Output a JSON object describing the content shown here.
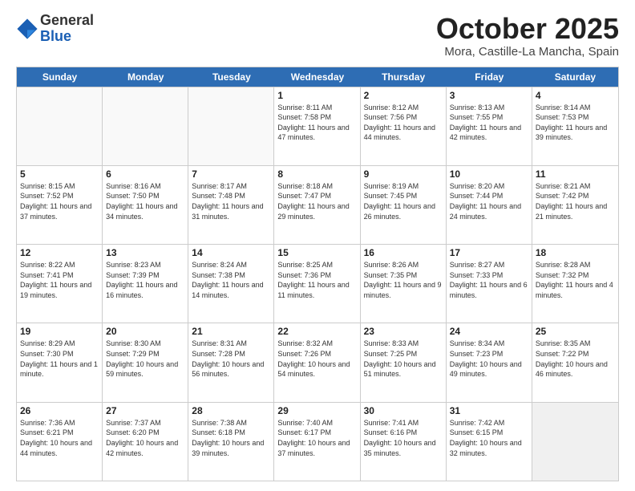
{
  "logo": {
    "general": "General",
    "blue": "Blue"
  },
  "header": {
    "month": "October 2025",
    "location": "Mora, Castille-La Mancha, Spain"
  },
  "weekdays": [
    "Sunday",
    "Monday",
    "Tuesday",
    "Wednesday",
    "Thursday",
    "Friday",
    "Saturday"
  ],
  "weeks": [
    [
      {
        "day": "",
        "info": "",
        "empty": true
      },
      {
        "day": "",
        "info": "",
        "empty": true
      },
      {
        "day": "",
        "info": "",
        "empty": true
      },
      {
        "day": "1",
        "info": "Sunrise: 8:11 AM\nSunset: 7:58 PM\nDaylight: 11 hours and 47 minutes."
      },
      {
        "day": "2",
        "info": "Sunrise: 8:12 AM\nSunset: 7:56 PM\nDaylight: 11 hours and 44 minutes."
      },
      {
        "day": "3",
        "info": "Sunrise: 8:13 AM\nSunset: 7:55 PM\nDaylight: 11 hours and 42 minutes."
      },
      {
        "day": "4",
        "info": "Sunrise: 8:14 AM\nSunset: 7:53 PM\nDaylight: 11 hours and 39 minutes."
      }
    ],
    [
      {
        "day": "5",
        "info": "Sunrise: 8:15 AM\nSunset: 7:52 PM\nDaylight: 11 hours and 37 minutes."
      },
      {
        "day": "6",
        "info": "Sunrise: 8:16 AM\nSunset: 7:50 PM\nDaylight: 11 hours and 34 minutes."
      },
      {
        "day": "7",
        "info": "Sunrise: 8:17 AM\nSunset: 7:48 PM\nDaylight: 11 hours and 31 minutes."
      },
      {
        "day": "8",
        "info": "Sunrise: 8:18 AM\nSunset: 7:47 PM\nDaylight: 11 hours and 29 minutes."
      },
      {
        "day": "9",
        "info": "Sunrise: 8:19 AM\nSunset: 7:45 PM\nDaylight: 11 hours and 26 minutes."
      },
      {
        "day": "10",
        "info": "Sunrise: 8:20 AM\nSunset: 7:44 PM\nDaylight: 11 hours and 24 minutes."
      },
      {
        "day": "11",
        "info": "Sunrise: 8:21 AM\nSunset: 7:42 PM\nDaylight: 11 hours and 21 minutes."
      }
    ],
    [
      {
        "day": "12",
        "info": "Sunrise: 8:22 AM\nSunset: 7:41 PM\nDaylight: 11 hours and 19 minutes."
      },
      {
        "day": "13",
        "info": "Sunrise: 8:23 AM\nSunset: 7:39 PM\nDaylight: 11 hours and 16 minutes."
      },
      {
        "day": "14",
        "info": "Sunrise: 8:24 AM\nSunset: 7:38 PM\nDaylight: 11 hours and 14 minutes."
      },
      {
        "day": "15",
        "info": "Sunrise: 8:25 AM\nSunset: 7:36 PM\nDaylight: 11 hours and 11 minutes."
      },
      {
        "day": "16",
        "info": "Sunrise: 8:26 AM\nSunset: 7:35 PM\nDaylight: 11 hours and 9 minutes."
      },
      {
        "day": "17",
        "info": "Sunrise: 8:27 AM\nSunset: 7:33 PM\nDaylight: 11 hours and 6 minutes."
      },
      {
        "day": "18",
        "info": "Sunrise: 8:28 AM\nSunset: 7:32 PM\nDaylight: 11 hours and 4 minutes."
      }
    ],
    [
      {
        "day": "19",
        "info": "Sunrise: 8:29 AM\nSunset: 7:30 PM\nDaylight: 11 hours and 1 minute."
      },
      {
        "day": "20",
        "info": "Sunrise: 8:30 AM\nSunset: 7:29 PM\nDaylight: 10 hours and 59 minutes."
      },
      {
        "day": "21",
        "info": "Sunrise: 8:31 AM\nSunset: 7:28 PM\nDaylight: 10 hours and 56 minutes."
      },
      {
        "day": "22",
        "info": "Sunrise: 8:32 AM\nSunset: 7:26 PM\nDaylight: 10 hours and 54 minutes."
      },
      {
        "day": "23",
        "info": "Sunrise: 8:33 AM\nSunset: 7:25 PM\nDaylight: 10 hours and 51 minutes."
      },
      {
        "day": "24",
        "info": "Sunrise: 8:34 AM\nSunset: 7:23 PM\nDaylight: 10 hours and 49 minutes."
      },
      {
        "day": "25",
        "info": "Sunrise: 8:35 AM\nSunset: 7:22 PM\nDaylight: 10 hours and 46 minutes."
      }
    ],
    [
      {
        "day": "26",
        "info": "Sunrise: 7:36 AM\nSunset: 6:21 PM\nDaylight: 10 hours and 44 minutes."
      },
      {
        "day": "27",
        "info": "Sunrise: 7:37 AM\nSunset: 6:20 PM\nDaylight: 10 hours and 42 minutes."
      },
      {
        "day": "28",
        "info": "Sunrise: 7:38 AM\nSunset: 6:18 PM\nDaylight: 10 hours and 39 minutes."
      },
      {
        "day": "29",
        "info": "Sunrise: 7:40 AM\nSunset: 6:17 PM\nDaylight: 10 hours and 37 minutes."
      },
      {
        "day": "30",
        "info": "Sunrise: 7:41 AM\nSunset: 6:16 PM\nDaylight: 10 hours and 35 minutes."
      },
      {
        "day": "31",
        "info": "Sunrise: 7:42 AM\nSunset: 6:15 PM\nDaylight: 10 hours and 32 minutes."
      },
      {
        "day": "",
        "info": "",
        "empty": true,
        "shaded": true
      }
    ]
  ]
}
